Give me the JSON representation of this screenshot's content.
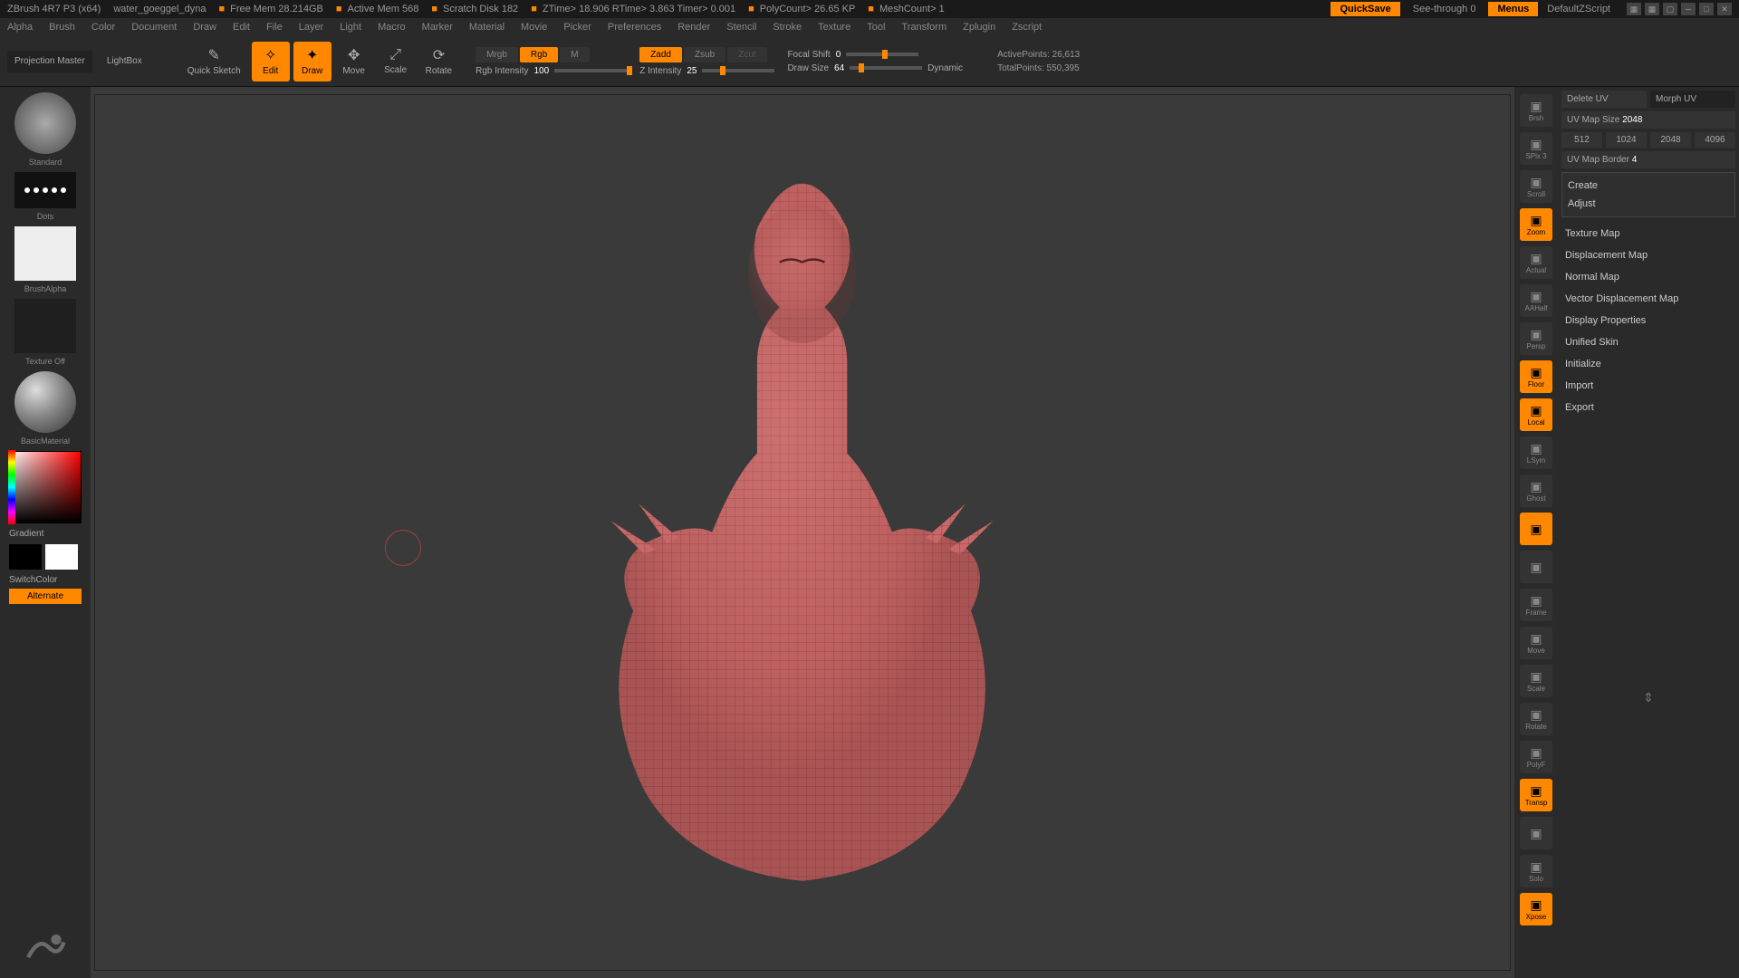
{
  "title_bar": {
    "app": "ZBrush 4R7 P3 (x64)",
    "doc": "water_goeggel_dyna",
    "free_mem": "Free Mem 28.214GB",
    "active_mem": "Active Mem 568",
    "scratch": "Scratch Disk 182",
    "ztime": "ZTime> 18.906  RTime> 3.863  Timer> 0.001",
    "polycount": "PolyCount> 26.65 KP",
    "meshcount": "MeshCount> 1",
    "quicksave": "QuickSave",
    "see_through": "See-through  0",
    "menus": "Menus",
    "script": "DefaultZScript"
  },
  "menu": [
    "Alpha",
    "Brush",
    "Color",
    "Document",
    "Draw",
    "Edit",
    "File",
    "Layer",
    "Light",
    "Macro",
    "Marker",
    "Material",
    "Movie",
    "Picker",
    "Preferences",
    "Render",
    "Stencil",
    "Stroke",
    "Texture",
    "Tool",
    "Transform",
    "Zplugin",
    "Zscript"
  ],
  "toolbar": {
    "projection": "Projection\nMaster",
    "lightbox": "LightBox",
    "quick_sketch": "Quick\nSketch",
    "edit": "Edit",
    "draw": "Draw",
    "move": "Move",
    "scale": "Scale",
    "rotate": "Rotate",
    "mrgb": "Mrgb",
    "rgb": "Rgb",
    "m_mode": "M",
    "rgb_intensity_lbl": "Rgb Intensity",
    "rgb_intensity_val": "100",
    "zadd": "Zadd",
    "zsub": "Zsub",
    "zcut": "Zcut",
    "z_intensity_lbl": "Z Intensity",
    "z_intensity_val": "25",
    "focal_lbl": "Focal Shift",
    "focal_val": "0",
    "draw_size_lbl": "Draw Size",
    "draw_size_val": "64",
    "dynamic": "Dynamic",
    "active_pts": "ActivePoints: 26,613",
    "total_pts": "TotalPoints: 550,395"
  },
  "left": {
    "brush": "Standard",
    "stroke": "Dots",
    "alpha": "BrushAlpha",
    "texture": "Texture Off",
    "material": "BasicMaterial",
    "gradient": "Gradient",
    "switch": "SwitchColor",
    "alternate": "Alternate"
  },
  "right_tools": [
    "Brsh",
    "SPix 3",
    "Scroll",
    "Zoom",
    "Actual",
    "AAHalf",
    "Persp",
    "Floor",
    "Local",
    "LSym",
    "Ghost",
    "",
    "",
    "Frame",
    "Move",
    "Scale",
    "Rotate",
    "PolyF",
    "Transp",
    "",
    "Solo",
    "Xpose"
  ],
  "right_tools_active": [
    3,
    7,
    8,
    11,
    18,
    21
  ],
  "right_panel": {
    "delete_uv": "Delete UV",
    "morph_uv": "Morph UV",
    "map_size_lbl": "UV Map Size",
    "map_size_val": "2048",
    "sizes": [
      "512",
      "1024",
      "2048",
      "4096"
    ],
    "border_lbl": "UV Map Border",
    "border_val": "4",
    "create": "Create",
    "adjust": "Adjust",
    "items": [
      "Texture Map",
      "Displacement Map",
      "Normal Map",
      "Vector Displacement Map",
      "Display Properties",
      "Unified Skin",
      "Initialize",
      "Import",
      "Export"
    ]
  }
}
